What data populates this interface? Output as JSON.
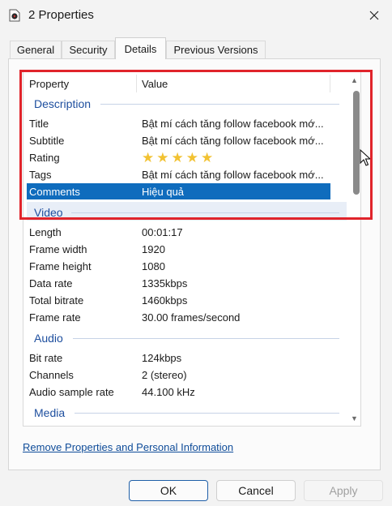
{
  "window": {
    "title": "2 Properties"
  },
  "tabs": [
    {
      "label": "General"
    },
    {
      "label": "Security"
    },
    {
      "label": "Details"
    },
    {
      "label": "Previous Versions"
    }
  ],
  "list": {
    "header_property": "Property",
    "header_value": "Value",
    "groups": {
      "description": "Description",
      "video": "Video",
      "audio": "Audio",
      "media": "Media"
    },
    "description_rows": [
      {
        "prop": "Title",
        "value": "Bật mí cách tăng follow facebook mớ..."
      },
      {
        "prop": "Subtitle",
        "value": "Bật mí cách tăng follow facebook mớ..."
      },
      {
        "prop": "Rating",
        "value": ""
      },
      {
        "prop": "Tags",
        "value": "Bật mí cách tăng follow facebook mớ..."
      },
      {
        "prop": "Comments",
        "value": "Hiệu quả"
      }
    ],
    "rating_stars": "★★★★★",
    "video_rows": [
      {
        "prop": "Length",
        "value": "00:01:17"
      },
      {
        "prop": "Frame width",
        "value": "1920"
      },
      {
        "prop": "Frame height",
        "value": "1080"
      },
      {
        "prop": "Data rate",
        "value": "1335kbps"
      },
      {
        "prop": "Total bitrate",
        "value": "1460kbps"
      },
      {
        "prop": "Frame rate",
        "value": "30.00 frames/second"
      }
    ],
    "audio_rows": [
      {
        "prop": "Bit rate",
        "value": "124kbps"
      },
      {
        "prop": "Channels",
        "value": "2 (stereo)"
      },
      {
        "prop": "Audio sample rate",
        "value": "44.100 kHz"
      }
    ]
  },
  "links": {
    "remove": "Remove Properties and Personal Information"
  },
  "buttons": {
    "ok": "OK",
    "cancel": "Cancel",
    "apply": "Apply"
  },
  "colors": {
    "selection": "#0f6cbd",
    "group_text": "#1d4e9e",
    "highlight_box": "#e0242b",
    "star": "#f2c232"
  }
}
